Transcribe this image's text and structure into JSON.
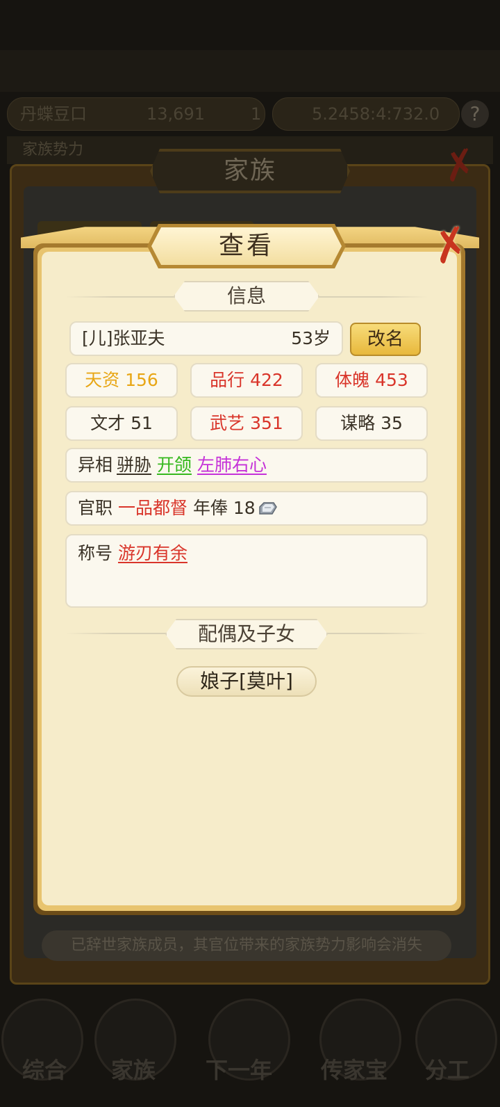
{
  "background": {
    "resources": [
      "丹蝶豆口",
      "13,691",
      "1",
      "5.2458:4:732.0"
    ],
    "subtitle_text": "家族势力",
    "outer_title": "家族",
    "bottom_note": "已辞世家族成员，其官位带来的家族势力影响会消失",
    "nav": [
      "综合",
      "家族",
      "下一年",
      "传家宝",
      "分工"
    ]
  },
  "dialog": {
    "title": "查看",
    "section_info": "信息",
    "member_name": "[儿]张亚夫",
    "member_age": "53岁",
    "rename_label": "改名",
    "stats": [
      {
        "label": "天资",
        "value": "156",
        "color": "#e8a615"
      },
      {
        "label": "品行",
        "value": "422",
        "color": "#d9352a"
      },
      {
        "label": "体魄",
        "value": "453",
        "color": "#d9352a"
      },
      {
        "label": "文才",
        "value": "51",
        "color": "#3a3226"
      },
      {
        "label": "武艺",
        "value": "351",
        "color": "#d9352a"
      },
      {
        "label": "谋略",
        "value": "35",
        "color": "#3a3226"
      }
    ],
    "traits": {
      "label": "异相",
      "items": [
        {
          "text": "骈胁",
          "color": "#3a3226"
        },
        {
          "text": "开颌",
          "color": "#36b81e"
        },
        {
          "text": "左肺右心",
          "color": "#c531d8"
        }
      ]
    },
    "office": {
      "label": "官职",
      "rank": "一品都督",
      "salary_label": "年俸",
      "salary_value": "18",
      "salary_icon": "silver-ingot-icon"
    },
    "title_row": {
      "label": "称号",
      "value": "游刃有余"
    },
    "section_family": "配偶及子女",
    "spouse_label": "娘子[莫叶]"
  }
}
